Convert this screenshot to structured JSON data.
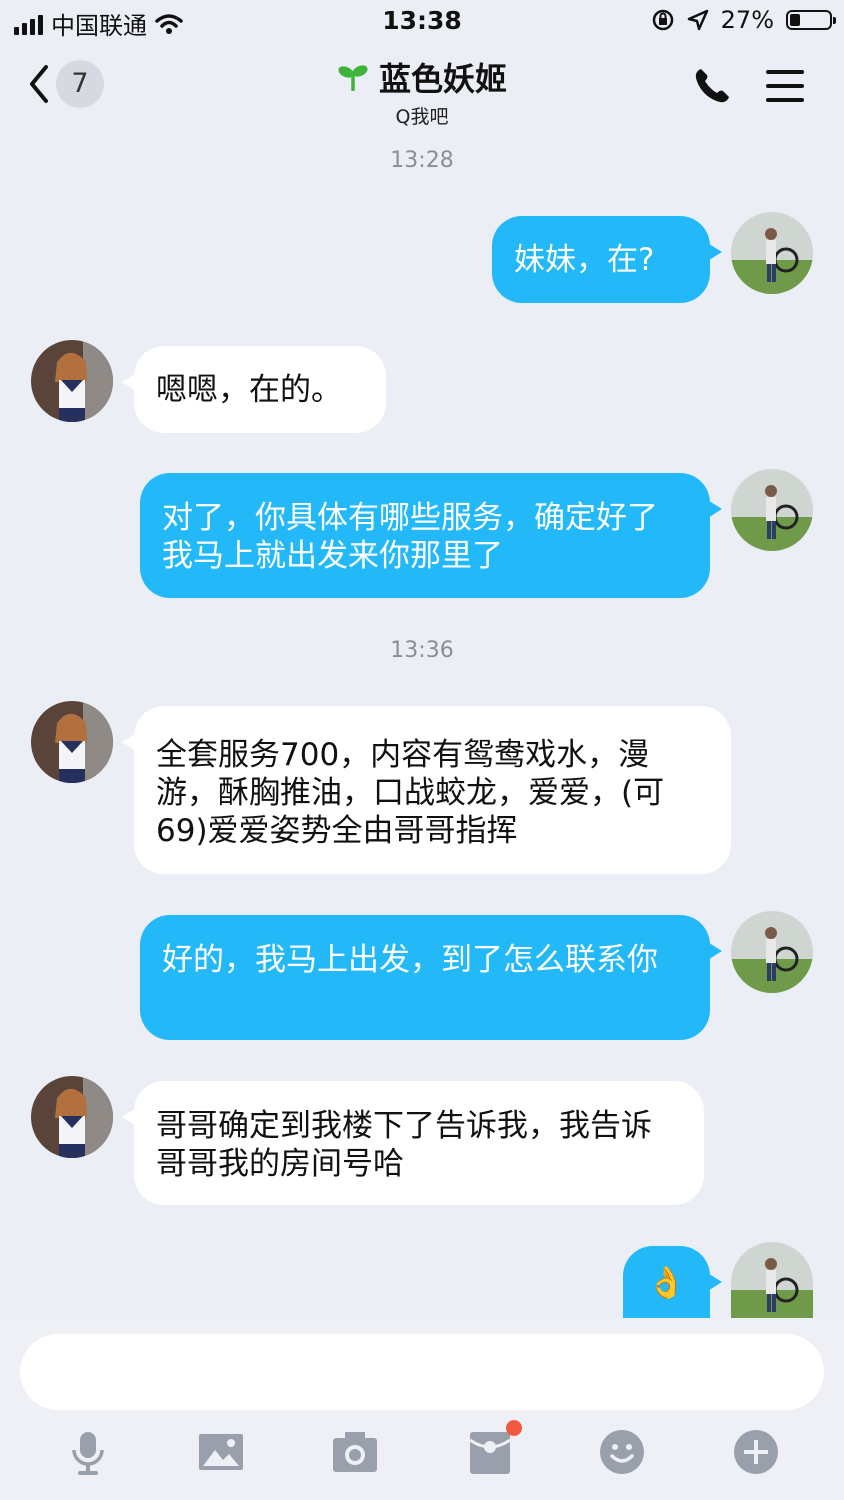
{
  "status_bar": {
    "carrier": "中国联通",
    "time": "13:38",
    "battery_text": "27%",
    "battery_level": 0.27
  },
  "header": {
    "back_count": "7",
    "title": "蓝色妖姬",
    "subtitle": "Q我吧"
  },
  "messages": [
    {
      "type": "time",
      "text": "13:28"
    },
    {
      "type": "out",
      "text": "妹妹，在?"
    },
    {
      "type": "in",
      "text": "嗯嗯，在的。"
    },
    {
      "type": "out",
      "text": "对了，你具体有哪些服务，确定好了我马上就出发来你那里了"
    },
    {
      "type": "time",
      "text": "13:36"
    },
    {
      "type": "in",
      "text": "全套服务700，内容有鸳鸯戏水，漫游，酥胸推油，口战蛟龙，爱爱，(可69)爱爱姿势全由哥哥指挥"
    },
    {
      "type": "out",
      "text": "好的，我马上出发，到了怎么联系你"
    },
    {
      "type": "in",
      "text": "哥哥确定到我楼下了告诉我，我告诉哥哥我的房间号哈"
    },
    {
      "type": "out",
      "text": "👌"
    }
  ],
  "input": {
    "value": "",
    "placeholder": ""
  },
  "toolbar": [
    "mic-icon",
    "image-icon",
    "camera-icon",
    "red-packet-icon",
    "emoji-icon",
    "plus-icon"
  ],
  "colors": {
    "background": "#eceef5",
    "outgoing_bubble": "#23b8f8",
    "incoming_bubble": "#ffffff",
    "badge": "#f25a40"
  }
}
